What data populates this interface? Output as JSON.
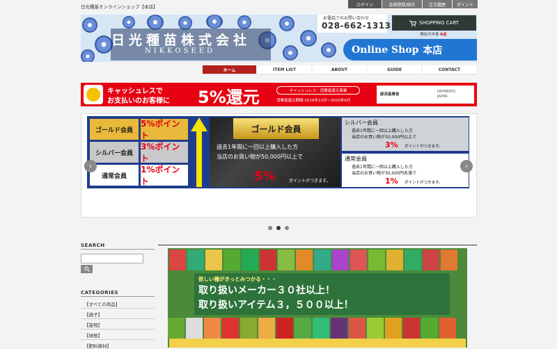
{
  "site_title": "日光種苗オンラインショップ【本店】",
  "top_nav": [
    "ログイン",
    "会員登録/修正",
    "注文履歴",
    "ポイント"
  ],
  "header": {
    "company_name": "日光種苗株式会社",
    "company_en": "NIKKOSEED",
    "online_shop": "Online Shop",
    "shop_suffix": "本店",
    "phone_label": "お電話でのお問い合わせ",
    "phone_number": "028-662-1313",
    "cart_label": "SHOPPING CART",
    "current_count_label": "現在の中身",
    "current_count_value": "0点"
  },
  "main_nav": [
    "ホーム",
    "ITEM LIST",
    "ABOUT",
    "GUIDE",
    "CONTACT"
  ],
  "cashless_banner": {
    "line1": "キャッシュレスで",
    "line2": "お支払いのお客様に",
    "big": "5%還元",
    "right_title": "キャッシュレス・消費者還元事業",
    "right_period": "消費者還元期間:2019年10月〜2020年6月",
    "logo1": "経済産業省",
    "logo2_line1": "PAYMENTS",
    "logo2_line2": "JAPAN"
  },
  "slider": {
    "tiers": [
      {
        "name": "ゴールド会員",
        "pts": "5%ポイント"
      },
      {
        "name": "シルバー会員",
        "pts": "3%ポイント"
      },
      {
        "name": "通常会員",
        "pts": "1%ポイント"
      }
    ],
    "gold": {
      "title": "ゴールド会員",
      "line1": "過去1年間に一回以上購入した方",
      "line2": "当店のお買い物が50,000円以上で",
      "pct": "5%",
      "pt_text": "ポイントがつきます。"
    },
    "silver": {
      "title": "シルバー会員",
      "line1": "過去1年間に一回以上購入した方",
      "line2": "当店のお買い物が30,000円以上で",
      "pct": "3%",
      "pt_text": "ポイントがつきます。"
    },
    "normal": {
      "title": "通常会員",
      "line1": "過去1年間に一回以上購入した方",
      "line2": "当店のお買い物が30,000円未満で",
      "pct": "1%",
      "pt_text": "ポイントがつきます。"
    },
    "prev_icon": "chevron-left-icon",
    "next_icon": "chevron-right-icon",
    "dots": 3,
    "active_dot": 1
  },
  "sidebar": {
    "search_heading": "SEARCH",
    "search_icon": "search-icon",
    "categories_heading": "CATEGORIES",
    "categories": [
      "【すべての商品】",
      "【適子】",
      "【苗物】",
      "【球根】",
      "【肥料資材】"
    ]
  },
  "main_banner": {
    "line1": "欲しい種がきっとみつかる・・・",
    "line2": "取り扱いメーカー３０社以上！",
    "line3": "取り扱いアイテム３，５００以上！"
  },
  "colors": {
    "accent": "#b3201e",
    "nav_gray": "#777777",
    "cashless_red": "#e60012",
    "shop_blue": "#2176d3"
  }
}
